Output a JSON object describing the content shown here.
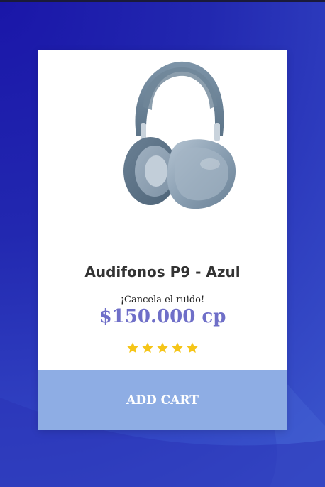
{
  "product": {
    "name": "Audifonos P9 - Azul",
    "tagline": "¡Cancela el ruido!",
    "price": "$150.000 cp",
    "rating": 5,
    "image_icon": "headphones-image"
  },
  "actions": {
    "add_cart_label": "ADD CART"
  },
  "colors": {
    "background": "#2228b0",
    "price": "#6f6fc8",
    "button": "#8eade4",
    "star": "#f5c518"
  }
}
